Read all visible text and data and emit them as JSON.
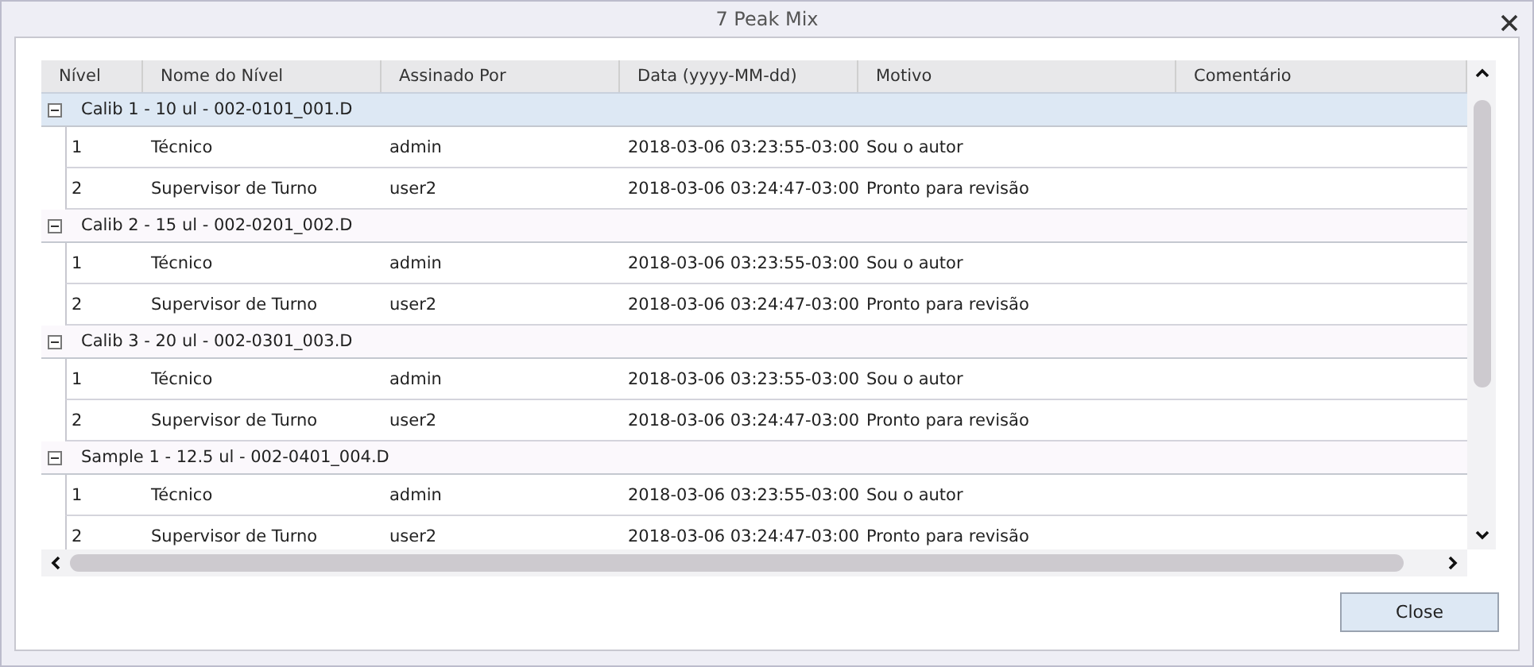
{
  "window": {
    "title": "7 Peak Mix"
  },
  "table": {
    "columns": [
      "Nível",
      "Nome do Nível",
      "Assinado Por",
      "Data (yyyy-MM-dd)",
      "Motivo",
      "Comentário"
    ],
    "groups": [
      {
        "label": "Calib 1 - 10 ul - 002-0101_001.D",
        "expanded": true,
        "selected": true,
        "rows": [
          [
            "1",
            "Técnico",
            "admin",
            "2018-03-06 03:23:55-03:00",
            "Sou o autor"
          ],
          [
            "2",
            "Supervisor de Turno",
            "user2",
            "2018-03-06 03:24:47-03:00",
            "Pronto para revisão"
          ]
        ]
      },
      {
        "label": "Calib 2 - 15 ul - 002-0201_002.D",
        "expanded": true,
        "selected": false,
        "rows": [
          [
            "1",
            "Técnico",
            "admin",
            "2018-03-06 03:23:55-03:00",
            "Sou o autor"
          ],
          [
            "2",
            "Supervisor de Turno",
            "user2",
            "2018-03-06 03:24:47-03:00",
            "Pronto para revisão"
          ]
        ]
      },
      {
        "label": "Calib 3 - 20 ul - 002-0301_003.D",
        "expanded": true,
        "selected": false,
        "rows": [
          [
            "1",
            "Técnico",
            "admin",
            "2018-03-06 03:23:55-03:00",
            "Sou o autor"
          ],
          [
            "2",
            "Supervisor de Turno",
            "user2",
            "2018-03-06 03:24:47-03:00",
            "Pronto para revisão"
          ]
        ]
      },
      {
        "label": "Sample 1 - 12.5 ul - 002-0401_004.D",
        "expanded": true,
        "selected": false,
        "rows": [
          [
            "1",
            "Técnico",
            "admin",
            "2018-03-06 03:23:55-03:00",
            "Sou o autor"
          ],
          [
            "2",
            "Supervisor de Turno",
            "user2",
            "2018-03-06 03:24:47-03:00",
            "Pronto para revisão"
          ]
        ]
      }
    ]
  },
  "buttons": [
    "Close"
  ]
}
